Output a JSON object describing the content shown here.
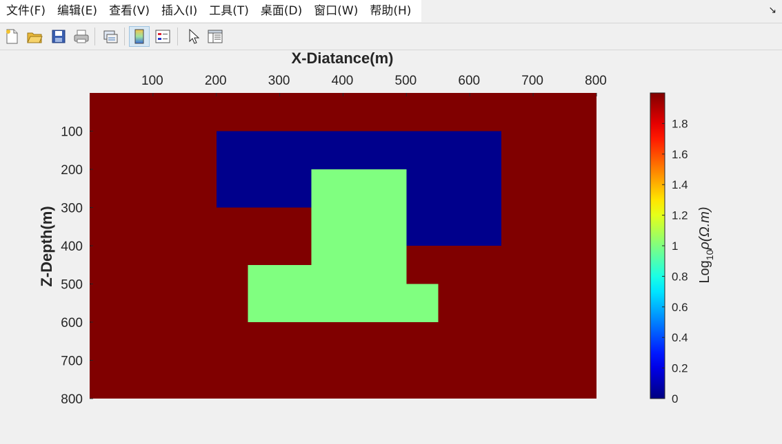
{
  "menu": {
    "items": [
      "文件(F)",
      "编辑(E)",
      "查看(V)",
      "插入(I)",
      "工具(T)",
      "桌面(D)",
      "窗口(W)",
      "帮助(H)"
    ],
    "corner_icon": "dock-arrow-icon"
  },
  "toolbar": {
    "buttons": [
      {
        "name": "new-figure-icon"
      },
      {
        "name": "open-file-icon"
      },
      {
        "name": "save-icon"
      },
      {
        "name": "print-icon"
      },
      {
        "name": "link-plot-icon"
      },
      {
        "name": "insert-colorbar-icon",
        "active": true
      },
      {
        "name": "insert-legend-icon"
      },
      {
        "name": "pointer-icon"
      },
      {
        "name": "property-inspector-icon"
      }
    ]
  },
  "chart_data": {
    "type": "heatmap",
    "xlabel": "X-Diatance(m)",
    "ylabel": "Z-Depth(m)",
    "x_ticks": [
      100,
      200,
      300,
      400,
      500,
      600,
      700,
      800
    ],
    "y_ticks": [
      100,
      200,
      300,
      400,
      500,
      600,
      700,
      800
    ],
    "xlim": [
      0,
      800
    ],
    "ylim": [
      0,
      800
    ],
    "x_axis_location": "top",
    "y_reversed": true,
    "background_value": 2.0,
    "regions": [
      {
        "x": [
          200,
          650
        ],
        "y": [
          100,
          300
        ],
        "value": 0.0
      },
      {
        "x": [
          500,
          650
        ],
        "y": [
          300,
          400
        ],
        "value": 0.0
      },
      {
        "x": [
          350,
          500
        ],
        "y": [
          200,
          600
        ],
        "value": 1.0
      },
      {
        "x": [
          250,
          350
        ],
        "y": [
          450,
          600
        ],
        "value": 1.0
      },
      {
        "x": [
          500,
          550
        ],
        "y": [
          500,
          600
        ],
        "value": 1.0
      }
    ],
    "colormap": "jet",
    "colorbar": {
      "label_base": "Log",
      "label_sub": "10",
      "label_rest": "ρ(Ω.m)",
      "ticks": [
        "0",
        "0.2",
        "0.4",
        "0.6",
        "0.8",
        "1",
        "1.2",
        "1.4",
        "1.6",
        "1.8"
      ],
      "range": [
        0,
        2
      ]
    },
    "colors": {
      "high": "#800000",
      "low": "#00008c",
      "mid": "#80ff80"
    }
  }
}
